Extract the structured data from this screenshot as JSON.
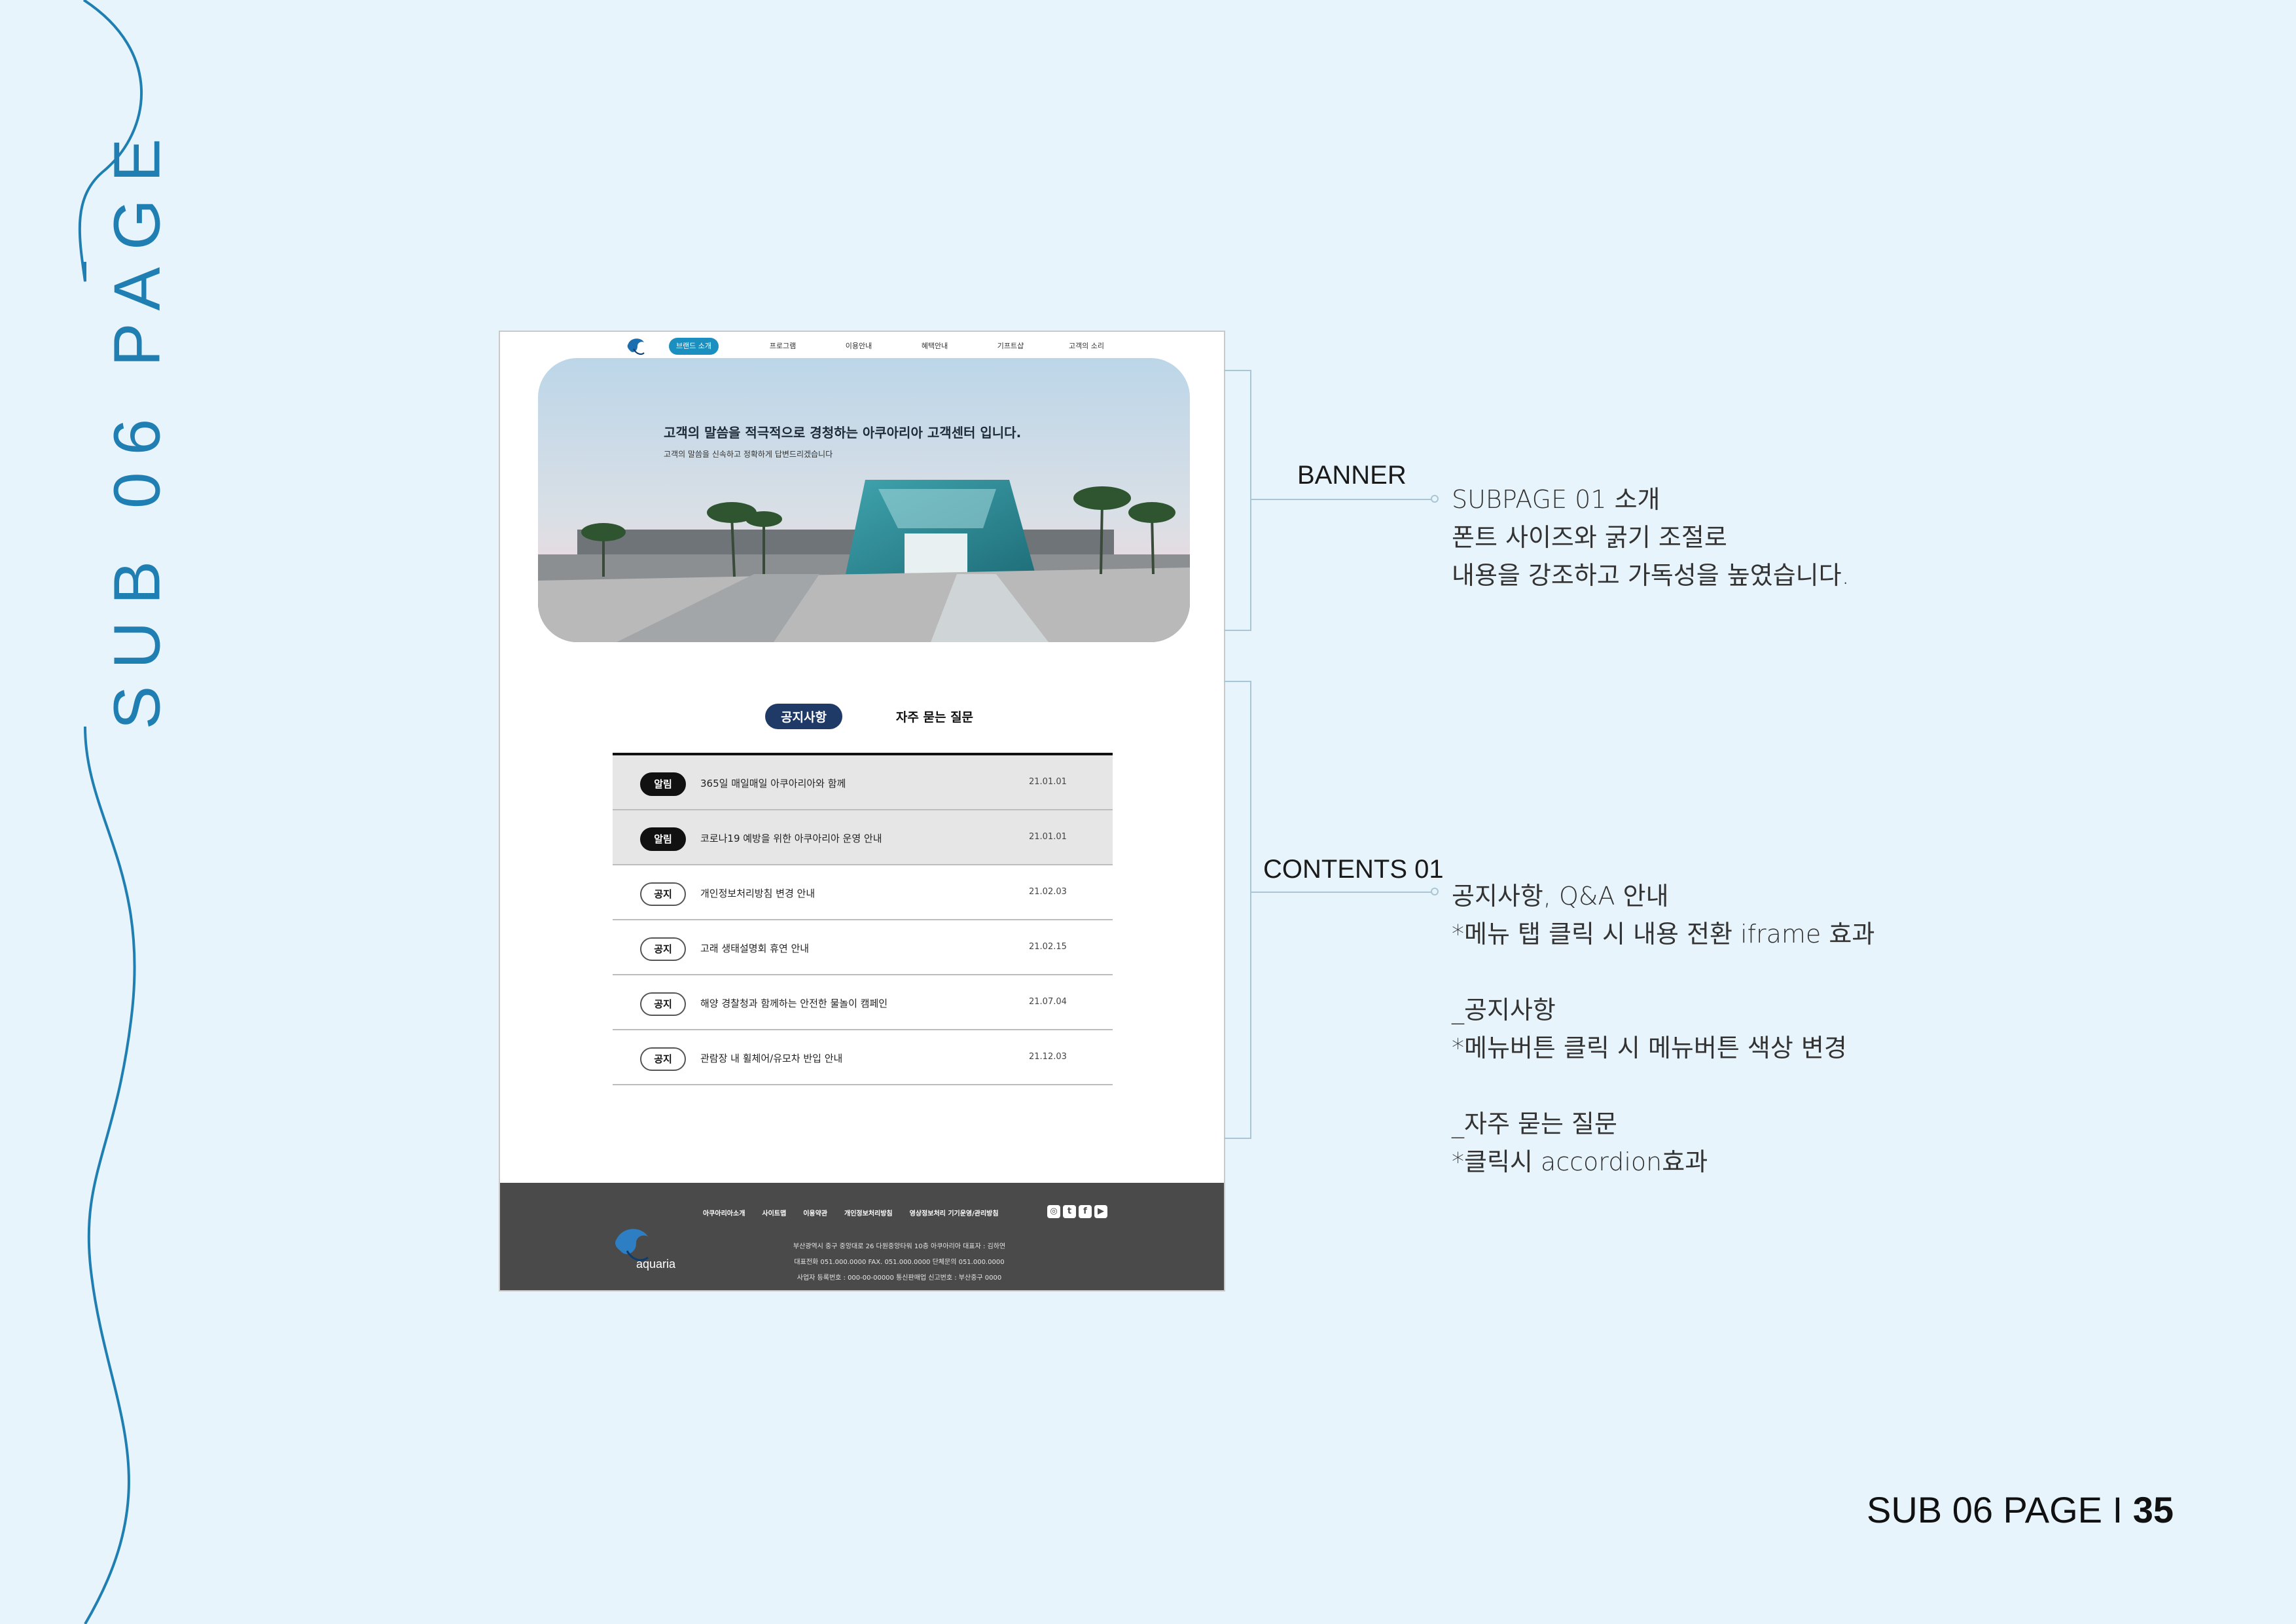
{
  "side_title": "SUB 06 PAGE",
  "nav": {
    "items": [
      "브랜드 소개",
      "프로그램",
      "이용안내",
      "혜택안내",
      "기프트샵",
      "고객의 소리"
    ]
  },
  "banner": {
    "title": "고객의 말씀을 적극적으로 경청하는 아쿠아리아 고객센터 입니다.",
    "subtitle": "고객의 말씀을 신속하고 정확하게 답변드리겠습니다"
  },
  "tabs": [
    "공지사항",
    "자주 묻는 질문"
  ],
  "notices": [
    {
      "badge": "알림",
      "title": "365일 매일매일 아쿠아리아와 함께",
      "date": "21.01.01"
    },
    {
      "badge": "알림",
      "title": "코로나19 예방을 위한 아쿠아리아 운영 안내",
      "date": "21.01.01"
    },
    {
      "badge": "공지",
      "title": "개인정보처리방침 변경 안내",
      "date": "21.02.03"
    },
    {
      "badge": "공지",
      "title": "고래 생태설명회 휴연 안내",
      "date": "21.02.15"
    },
    {
      "badge": "공지",
      "title": "해양 경찰청과 함께하는 안전한 물놀이 캠페인",
      "date": "21.07.04"
    },
    {
      "badge": "공지",
      "title": "관람장 내 휠체어/유모차 반입 안내",
      "date": "21.12.03"
    }
  ],
  "footer": {
    "logo_text": "aquaria",
    "links": [
      "아쿠아리아소개",
      "사이트맵",
      "이용약관",
      "개인정보처리방침",
      "영상정보처리 기기운영/관리방침"
    ],
    "social_icons": [
      "instagram-icon",
      "twitter-icon",
      "facebook-icon",
      "youtube-icon"
    ],
    "info": [
      "부산광역시 중구 중앙대로 26 다원중앙타워 10층 아쿠아리아 대표자 : 김하연",
      "대표전화 051.000.0000  FAX. 051.000.0000  단체문의 051.000.0000",
      "사업자 등록번호 : 000-00-00000 통신판매업 신고번호 : 부산중구 0000"
    ]
  },
  "annotations": {
    "banner_label": "BANNER",
    "banner_text": "SUBPAGE 01 소개\n폰트 사이즈와 굵기 조절로\n내용을 강조하고 가독성을 높였습니다.",
    "contents_label": "CONTENTS 01",
    "contents_text": "공지사항, Q&A 안내\n*메뉴 탭 클릭 시 내용 전환 iframe 효과\n\n_공지사항\n*메뉴버튼 클릭 시 메뉴버튼 색상 변경\n\n_자주 묻는 질문\n*클릭시 accordion효과"
  },
  "page_number": {
    "prefix": "SUB 06 PAGE I ",
    "number": "35"
  },
  "colors": {
    "background": "#e8f4fb",
    "accent": "#1f7fb3",
    "tab_active": "#1f3a66",
    "footer": "#4a4a4a"
  }
}
